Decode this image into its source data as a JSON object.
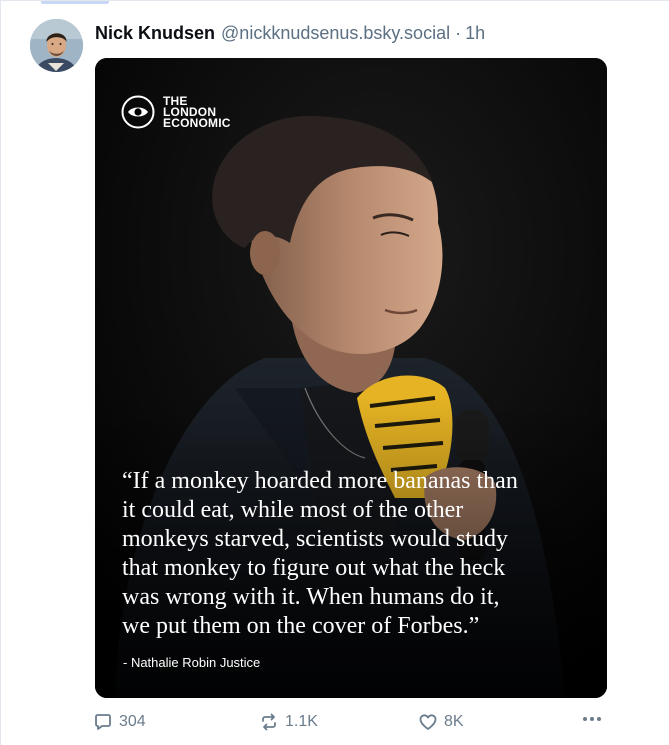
{
  "post": {
    "author": {
      "display_name": "Nick Knudsen",
      "handle": "@nickknudsenus.bsky.social",
      "separator": "·",
      "time": "1h"
    },
    "image": {
      "brand_lines": [
        "THE",
        "LONDON",
        "ECONOMIC"
      ],
      "quote_lines": [
        "“If a monkey hoarded more bananas than",
        "it could eat, while most of the other",
        "monkeys starved, scientists would study",
        "that monkey to figure out what the heck",
        "was wrong with it. When humans do it,",
        "we put them on the cover of Forbes.”"
      ],
      "attribution": "- Nathalie Robin Justice"
    },
    "actions": {
      "replies": "304",
      "reposts": "1.1K",
      "likes": "8K"
    }
  },
  "colors": {
    "name": "#0b0f14",
    "meta": "#5b7083",
    "action": "#6b7c8c",
    "image_background": "#000000"
  },
  "icons": [
    "avatar",
    "london-economic-logo",
    "reply-icon",
    "repost-icon",
    "like-icon",
    "more-icon"
  ]
}
